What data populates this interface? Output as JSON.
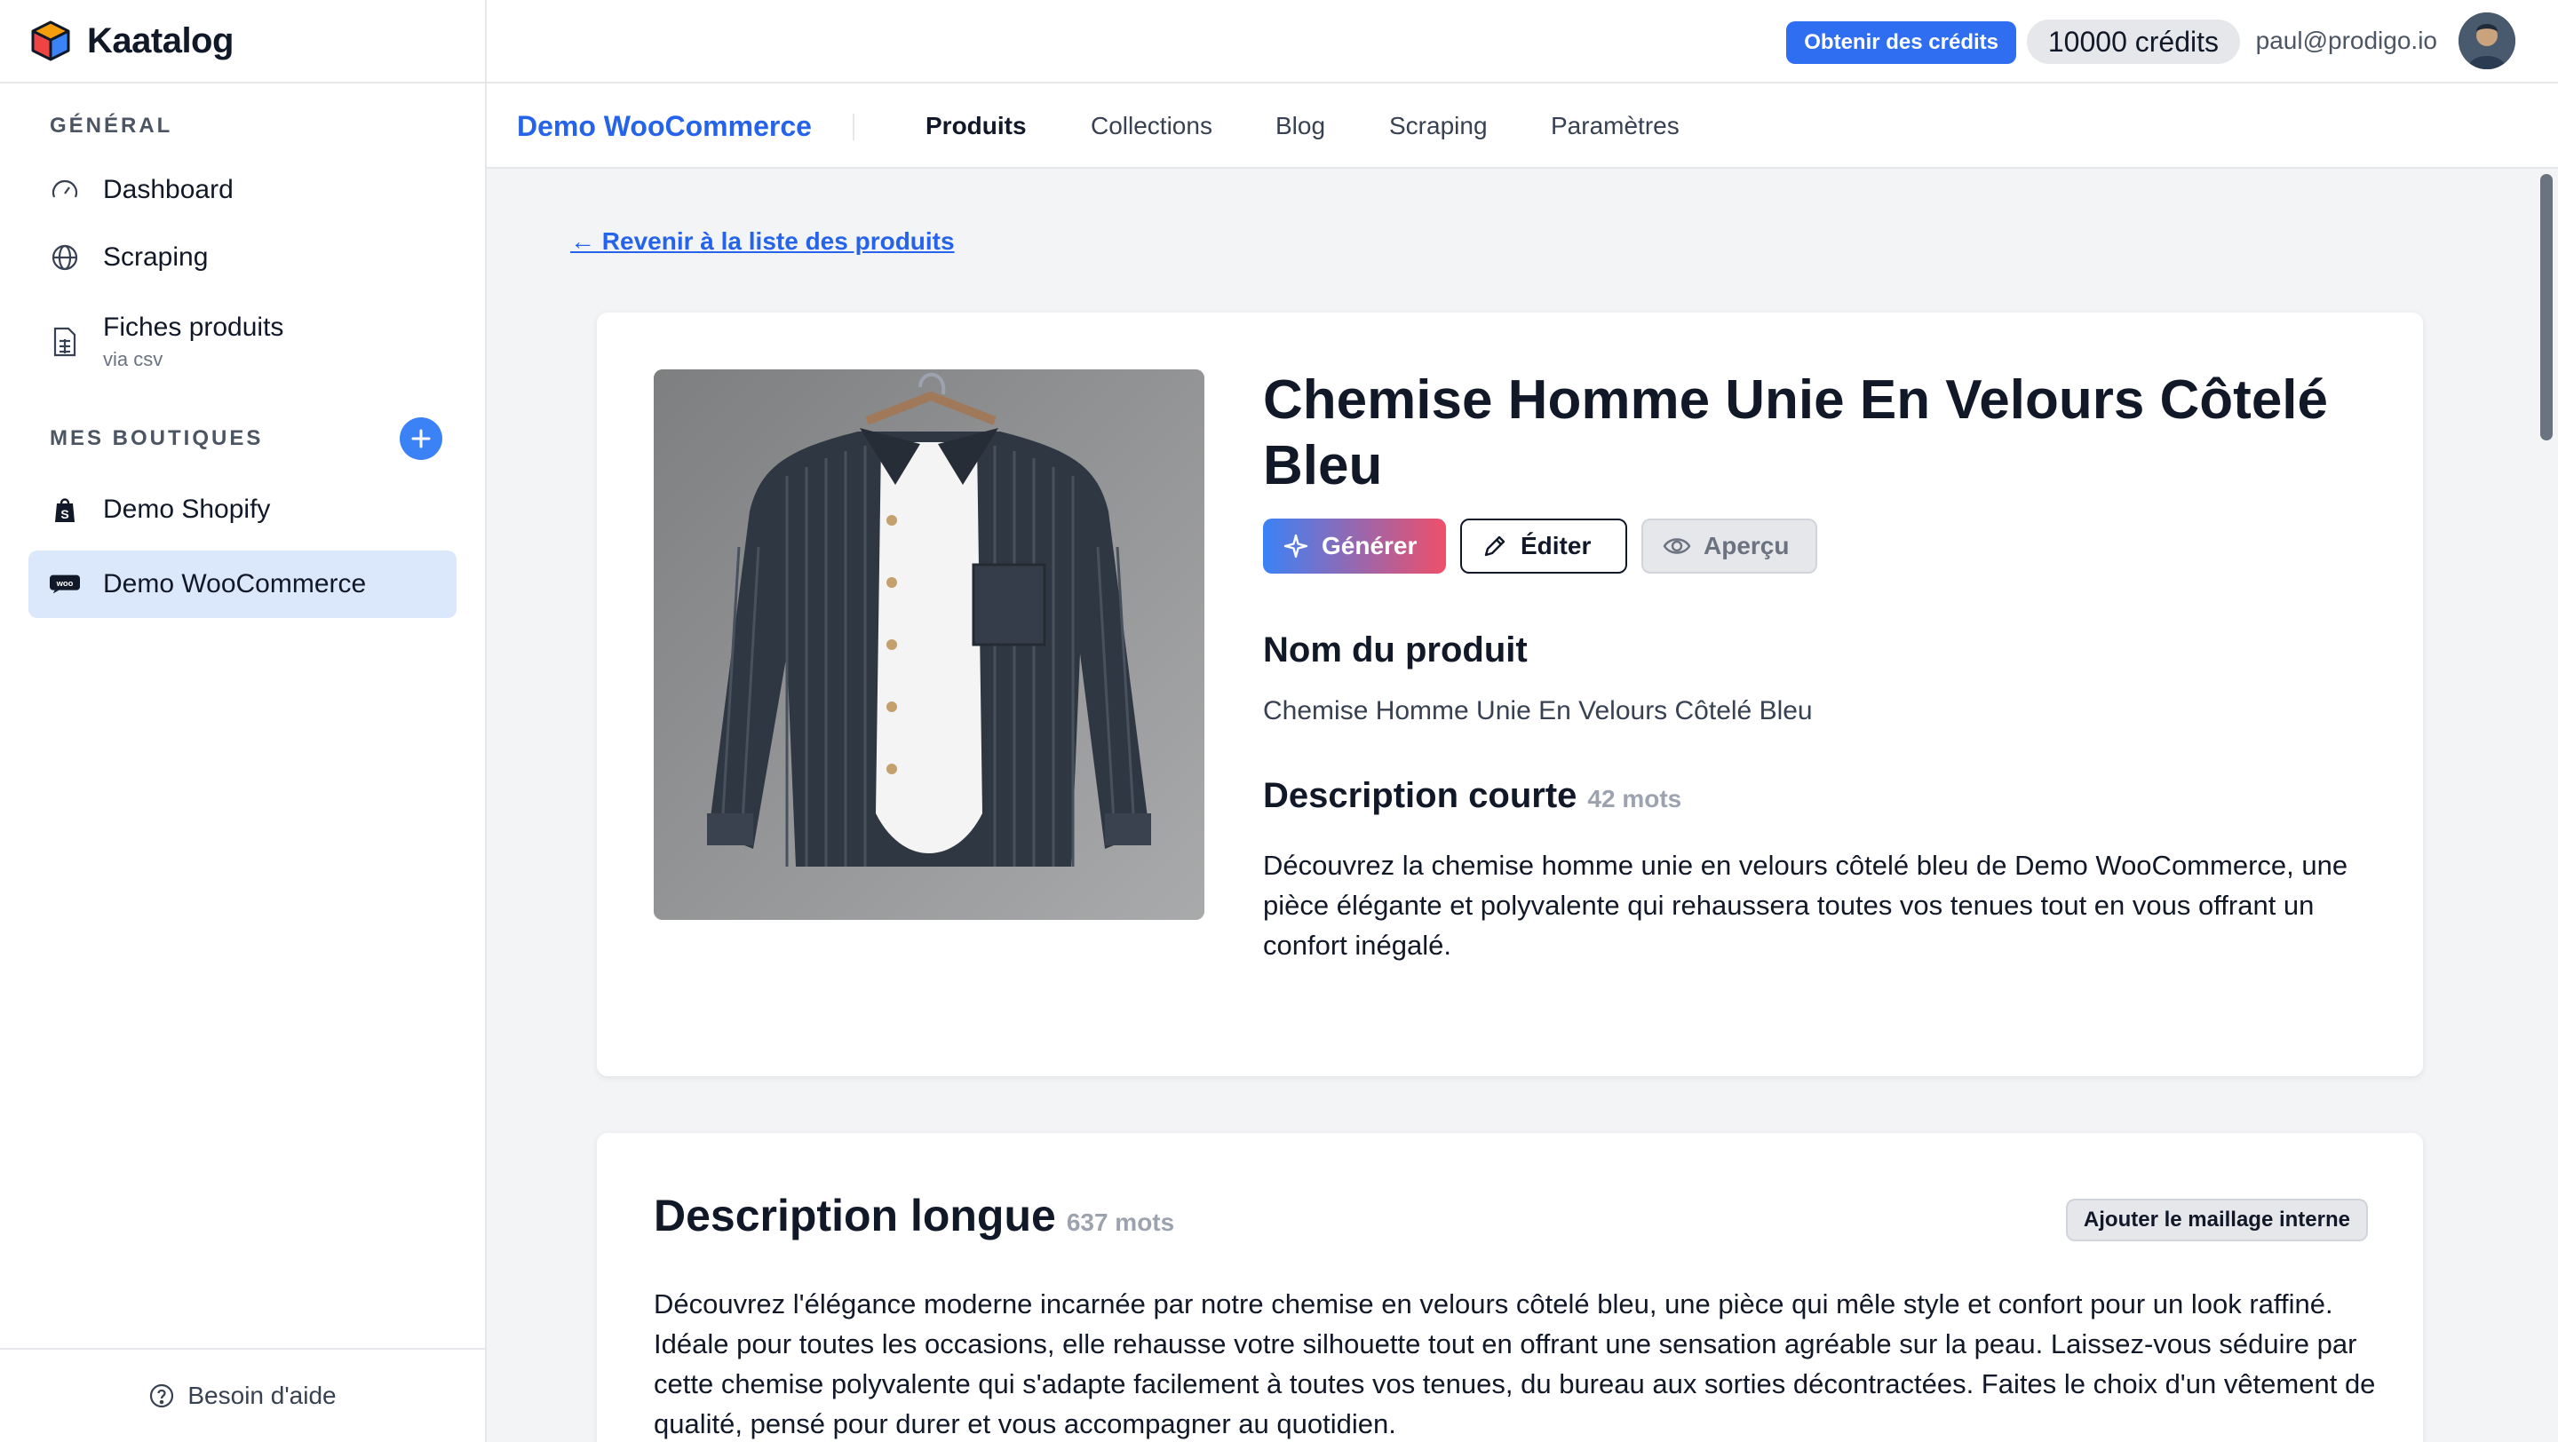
{
  "app": {
    "name": "Kaatalog"
  },
  "sidebar": {
    "general_label": "GÉNÉRAL",
    "items": [
      {
        "label": "Dashboard",
        "icon": "gauge-icon"
      },
      {
        "label": "Scraping",
        "icon": "globe-icon"
      },
      {
        "label": "Fiches produits",
        "sublabel": "via csv",
        "icon": "file-spreadsheet-icon"
      }
    ],
    "shops_label": "MES BOUTIQUES",
    "shops": [
      {
        "label": "Demo Shopify",
        "icon": "shopify-icon"
      },
      {
        "label": "Demo WooCommerce",
        "icon": "woocommerce-icon",
        "active": true
      }
    ],
    "help": "Besoin d'aide"
  },
  "topbar": {
    "get_credits": "Obtenir des crédits",
    "credits": "10000 crédits",
    "email": "paul@prodigo.io"
  },
  "subnav": {
    "shop": "Demo WooCommerce",
    "tabs": [
      "Produits",
      "Collections",
      "Blog",
      "Scraping",
      "Paramètres"
    ],
    "active_tab": "Produits"
  },
  "main": {
    "back_link": "← Revenir à la liste des produits",
    "product": {
      "title": "Chemise Homme Unie En Velours Côtelé Bleu",
      "actions": {
        "generate": "Générer",
        "edit": "Éditer",
        "preview": "Aperçu"
      },
      "name_heading": "Nom du produit",
      "name_value": "Chemise Homme Unie En Velours Côtelé Bleu",
      "short_heading": "Description courte",
      "short_count": "42 mots",
      "short_text": "Découvrez la chemise homme unie en velours côtelé bleu de Demo WooCommerce, une pièce élégante et polyvalente qui rehaussera toutes vos tenues tout en vous offrant un confort inégalé."
    },
    "long": {
      "heading": "Description longue",
      "count": "637 mots",
      "mesh_button": "Ajouter le maillage interne",
      "text": "Découvrez l'élégance moderne incarnée par notre chemise en velours côtelé bleu, une pièce qui mêle style et confort pour un look raffiné. Idéale pour toutes les occasions, elle rehausse votre silhouette tout en offrant une sensation agréable sur la peau. Laissez-vous séduire par cette chemise polyvalente qui s'adapte facilement à toutes vos tenues, du bureau aux sorties décontractées. Faites le choix d'un vêtement de qualité, pensé pour durer et vous accompagner au quotidien."
    }
  },
  "colors": {
    "accent": "#2563eb",
    "active_bg": "#dbe7fb",
    "credits_btn": "#2f6ef0"
  }
}
